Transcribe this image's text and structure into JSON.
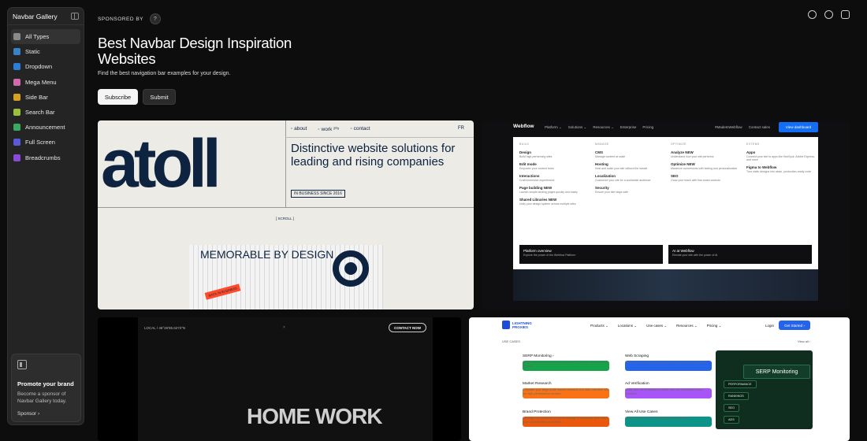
{
  "sidebar": {
    "title": "Navbar Gallery",
    "items": [
      {
        "label": "All Types",
        "icon": "grid-icon",
        "color": "#8a8a8a"
      },
      {
        "label": "Static",
        "icon": "static-icon",
        "color": "#3b82c4"
      },
      {
        "label": "Dropdown",
        "icon": "dropdown-icon",
        "color": "#2a7fd4"
      },
      {
        "label": "Mega Menu",
        "icon": "mega-menu-icon",
        "color": "#d06aa8"
      },
      {
        "label": "Side Bar",
        "icon": "sidebar-icon",
        "color": "#d8a020"
      },
      {
        "label": "Search Bar",
        "icon": "search-icon",
        "color": "#9bbf3a"
      },
      {
        "label": "Announcement",
        "icon": "announcement-icon",
        "color": "#3aa860"
      },
      {
        "label": "Full Screen",
        "icon": "fullscreen-icon",
        "color": "#5a5ad8"
      },
      {
        "label": "Breadcrumbs",
        "icon": "breadcrumbs-icon",
        "color": "#8a4ad8"
      }
    ],
    "promo": {
      "title": "Promote your brand",
      "text": "Become a sponsor of Navbar Gallery today.",
      "link": "Sponsor ›"
    }
  },
  "sponsor": {
    "label": "SPONSORED BY",
    "help": "?"
  },
  "hero": {
    "title": "Best Navbar Design Inspiration Websites",
    "subtitle": "Find the best navigation bar examples for your design.",
    "subscribe": "Subscribe",
    "submit": "Submit"
  },
  "cards": {
    "atoll": {
      "logo": "atoll",
      "nav": [
        "◦ about",
        "◦ work ²⁰⁵",
        "◦ contact"
      ],
      "lang": "FR",
      "headline": "Distinctive website solutions for leading and rising companies",
      "badge": "IN BUSINESS SINCE 2016",
      "scroll": "[ SCROLL ]",
      "poster": "MEMORABLE BY DESIGN",
      "poster_tag": "BACK IN BUSINESS"
    },
    "webflow": {
      "logo": "Webflow",
      "nav": [
        "Platform ⌄",
        "Solutions ⌄",
        "Resources ⌄",
        "Enterprise",
        "Pricing"
      ],
      "right": [
        "#MadeInWebflow",
        "Contact sales"
      ],
      "cta": "View dashboard",
      "columns": [
        {
          "heading": "BUILD",
          "items": [
            {
              "title": "Design",
              "desc": "Build high-performing sites"
            },
            {
              "title": "Edit mode",
              "desc": "Empower your content team"
            },
            {
              "title": "Interactions",
              "desc": "Craft immersive experiences"
            },
            {
              "title": "Page building NEW",
              "desc": "Launch simple landing pages quickly and easily"
            },
            {
              "title": "Shared Libraries NEW",
              "desc": "Unify your design system across multiple sites"
            }
          ]
        },
        {
          "heading": "MANAGE",
          "items": [
            {
              "title": "CMS",
              "desc": "Manage content at scale"
            },
            {
              "title": "Hosting",
              "desc": "Host and scale your site without the hassle"
            },
            {
              "title": "Localization",
              "desc": "Customize your site for a worldwide audience"
            },
            {
              "title": "Security",
              "desc": "Ensure your site stays safe"
            }
          ]
        },
        {
          "heading": "OPTIMIZE",
          "items": [
            {
              "title": "Analyze NEW",
              "desc": "Understand how your site performs"
            },
            {
              "title": "Optimize NEW",
              "desc": "Maximize conversions with testing and personalization"
            },
            {
              "title": "SEO",
              "desc": "Grow your reach with fine-tuned controls"
            }
          ]
        },
        {
          "heading": "EXTEND",
          "items": [
            {
              "title": "Apps",
              "desc": "Connect your site to apps like HubSpot, Adobe Express, and more"
            },
            {
              "title": "Figma to Webflow",
              "desc": "Turn static designs into clean, production-ready code"
            }
          ]
        }
      ],
      "footer": [
        {
          "title": "Platform overview",
          "desc": "Explore the power of the Webflow Platform"
        },
        {
          "title": "AI at Webflow",
          "desc": "Elevate your site with the power of AI"
        }
      ]
    },
    "homework": {
      "location": "LOCAL / 46°26'55.6272\"N",
      "close": "×",
      "cta": "CONTACT NOW",
      "big": "HOME WORK"
    },
    "lightning": {
      "logo": "LIGHTNING PROXIES",
      "nav": [
        "Products ⌄",
        "Locations ⌄",
        "Use cases ⌄",
        "Resources ⌄",
        "Pricing ⌄"
      ],
      "login": "Login",
      "cta": "Get Started ›",
      "section": "USE CASES",
      "view_all": "View all ›",
      "items": [
        {
          "title": "SERP Monitoring ›",
          "desc": "SERP data collection made easy with SERP Scraper API and SEO Proxies.",
          "color": "#16a34a"
        },
        {
          "title": "Web Scraping",
          "desc": "Initiate your web scraping projects with powerful proxy solutions.",
          "color": "#2563eb"
        },
        {
          "title": "Market Research",
          "desc": "Empower your large-scale market research and data collection with our high-performance proxies.",
          "color": "#f97316"
        },
        {
          "title": "Ad Verification",
          "desc": "Boost your ad verification projects with our specialized proxy solutions.",
          "color": "#a855f7"
        },
        {
          "title": "Brand Protection",
          "desc": "Leverage our advanced proxy technology to safeguard your brand from counterfeiters at all times.",
          "color": "#ea580c"
        },
        {
          "title": "View All Use Cases",
          "desc": "Learn more about all LightningProxies use cases.",
          "color": "#0d9488"
        }
      ],
      "panel_title": "SERP Monitoring",
      "tags": [
        "PERFORMANCE",
        "RANKINGS",
        "SEO",
        "ADS"
      ]
    }
  }
}
